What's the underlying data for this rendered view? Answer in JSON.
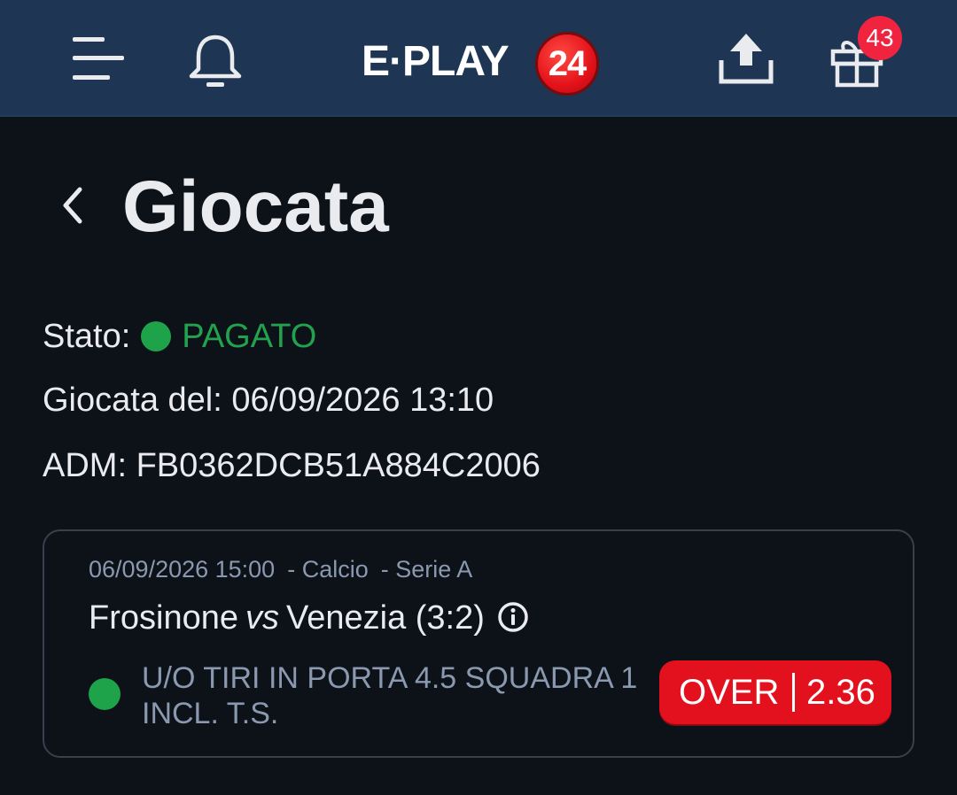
{
  "header": {
    "logo_text": "E·PLAY",
    "logo_badge": "24",
    "notifications_count": "43",
    "icons": [
      "menu-icon",
      "bell-icon",
      "upload-icon",
      "gift-icon"
    ],
    "brand_color": "#1e3553",
    "accent_color": "#e3101e"
  },
  "page": {
    "title": "Giocata",
    "back_icon": "chevron-left-icon"
  },
  "details": {
    "stato_label": "Stato:",
    "stato_value": "PAGATO",
    "stato_color": "#22a24e",
    "giocata_label": "Giocata del:",
    "giocata_value": "06/09/2026 13:10",
    "adm_label": "ADM:",
    "adm_value": "FB0362DCB51A884C2006"
  },
  "bet": {
    "datetime": "06/09/2026 15:00",
    "sport": "- Calcio",
    "league": "- Serie A",
    "home_team": "Frosinone",
    "vs": "vs",
    "away_team": "Venezia (3:2)",
    "market": "U/O TIRI IN PORTA 4.5 SQUADRA 1 INCL. T.S.",
    "pick": "OVER",
    "odd": "2.36"
  }
}
